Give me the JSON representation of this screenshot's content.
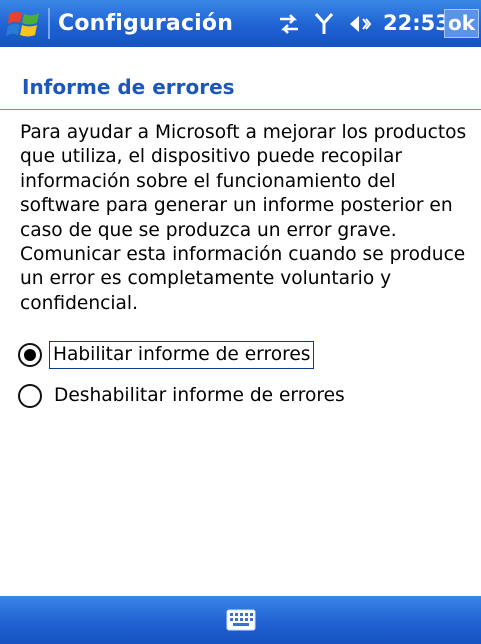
{
  "titlebar": {
    "app_title": "Configuración",
    "clock": "22:53",
    "ok_label": "ok",
    "icons": [
      "windows-start-icon",
      "sync-icon",
      "signal-icon",
      "volume-icon"
    ]
  },
  "page": {
    "heading": "Informe de errores",
    "description": "Para ayudar a Microsoft a mejorar los productos que utiliza, el dispositivo puede recopilar información sobre el funcionamiento del software para generar un informe posterior en caso de que se produzca un error grave. Comunicar esta información cuando se produce un error es completamente voluntario y confidencial."
  },
  "options": [
    {
      "label": "Habilitar informe de errores",
      "selected": true
    },
    {
      "label": "Deshabilitar informe de errores",
      "selected": false
    }
  ],
  "bottombar": {
    "icon": "keyboard-icon"
  },
  "colors": {
    "bar_blue": "#1f62d2",
    "heading_blue": "#1d57b8"
  }
}
